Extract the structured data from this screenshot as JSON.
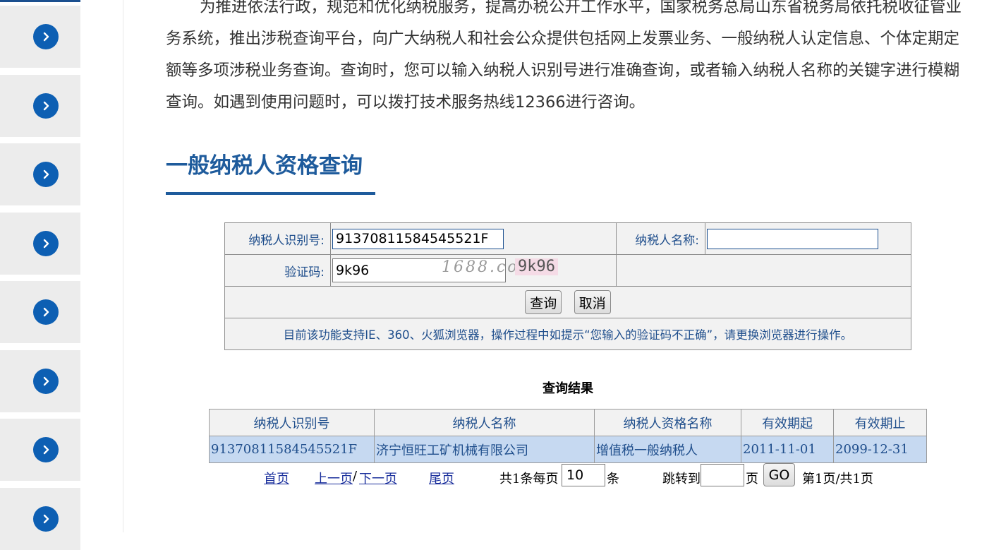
{
  "sidebar": {
    "item_count": 8,
    "icon": "chevron-right-icon"
  },
  "intro": "为推进依法行政，规范和优化纳税服务，提高办税公开工作水平，国家税务总局山东省税务局依托税收征管业务系统，推出涉税查询平台，向广大纳税人和社会公众提供包括网上发票业务、一般纳税人认定信息、个体定期定额等多项涉税业务查询。查询时，您可以输入纳税人识别号进行准确查询，或者输入纳税人名称的关键字进行模糊查询。如遇到使用问题时，可以拨打技术服务热线12366进行咨询。",
  "section_title": "一般纳税人资格查询",
  "form": {
    "tin_label": "纳税人识别号:",
    "tin_value": "91370811584545521F",
    "name_label": "纳税人名称:",
    "name_value": "",
    "captcha_label": "验证码:",
    "captcha_value": "9k96",
    "captcha_image_text": "1688.com",
    "captcha_code": "9k96",
    "query_button": "查询",
    "cancel_button": "取消",
    "notice": "目前该功能支持IE、360、火狐浏览器，操作过程中如提示“您输入的验证码不正确”，请更换浏览器进行操作。"
  },
  "results": {
    "title": "查询结果",
    "columns": [
      "纳税人识别号",
      "纳税人名称",
      "纳税人资格名称",
      "有效期起",
      "有效期止"
    ],
    "rows": [
      [
        "91370811584545521F",
        "济宁恒旺工矿机械有限公司",
        "增值税一般纳税人",
        "2011-11-01",
        "2099-12-31"
      ]
    ]
  },
  "pager": {
    "first": "首页",
    "prev": "上一页",
    "slash": "/",
    "next": "下一页",
    "last": "尾页",
    "total_prefix": "共1条每页",
    "per_page": "10",
    "per_page_suffix": "条",
    "jump_label": "跳转到",
    "jump_value": "",
    "page_suffix": "页",
    "go": "GO",
    "page_info": "第1页/共1页"
  },
  "colors": {
    "accent": "#1e5b9c",
    "sidebar_button": "#0d5fb3",
    "row_highlight": "#c6d9f1"
  }
}
